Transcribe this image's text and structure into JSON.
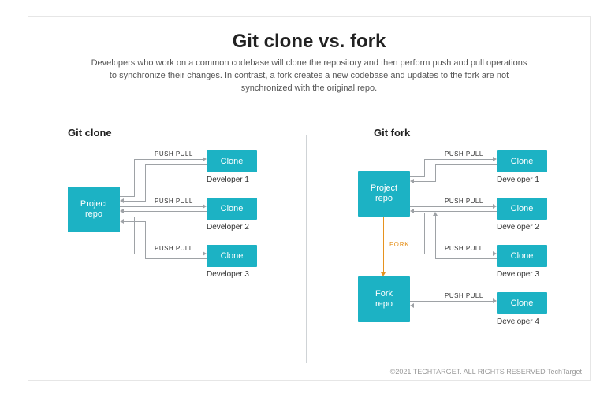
{
  "title": "Git clone vs. fork",
  "subtitle": "Developers who work on a common codebase will clone the repository and then perform push and pull operations to synchronize their changes. In contrast, a fork creates a new codebase and updates to the fork are not synchronized with the original repo.",
  "labels": {
    "push_pull": "PUSH PULL",
    "fork": "FORK"
  },
  "left": {
    "heading": "Git clone",
    "repo": "Project\nrepo",
    "clones": [
      {
        "box": "Clone",
        "dev": "Developer 1"
      },
      {
        "box": "Clone",
        "dev": "Developer 2"
      },
      {
        "box": "Clone",
        "dev": "Developer 3"
      }
    ]
  },
  "right": {
    "heading": "Git fork",
    "repo": "Project\nrepo",
    "fork_repo": "Fork\nrepo",
    "clones": [
      {
        "box": "Clone",
        "dev": "Developer 1"
      },
      {
        "box": "Clone",
        "dev": "Developer 2"
      },
      {
        "box": "Clone",
        "dev": "Developer 3"
      },
      {
        "box": "Clone",
        "dev": "Developer 4"
      }
    ]
  },
  "footer": "©2021 TECHTARGET. ALL RIGHTS RESERVED    TechTarget"
}
